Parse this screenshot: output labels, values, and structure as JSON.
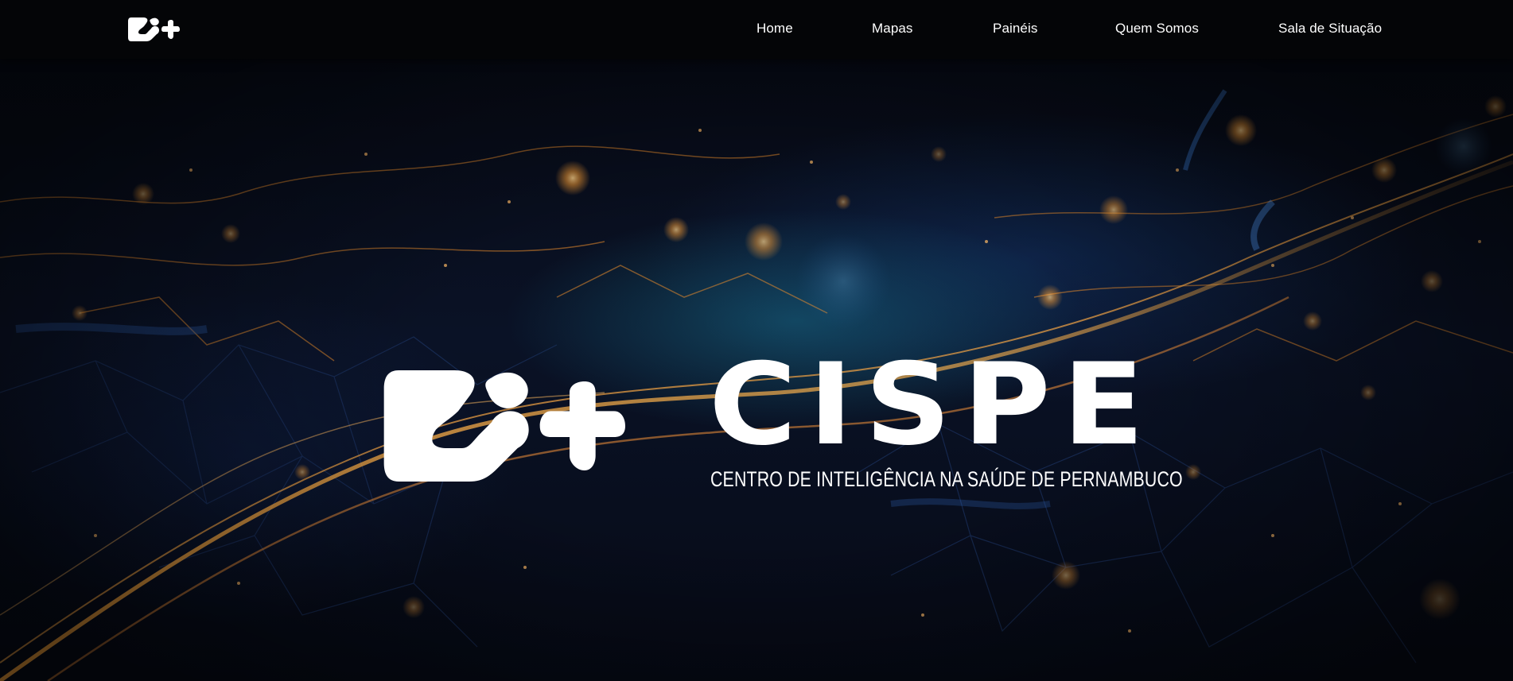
{
  "navbar": {
    "logo_icon": "cispe-logo-icon",
    "links": [
      {
        "label": "Home"
      },
      {
        "label": "Mapas"
      },
      {
        "label": "Painéis"
      },
      {
        "label": "Quem Somos"
      },
      {
        "label": "Sala de Situação"
      }
    ]
  },
  "hero": {
    "background": "network-lines-image",
    "logo_icon": "cispe-logo-icon",
    "title": "CISPE",
    "subtitle": "CENTRO DE INTELIGÊNCIA NA SAÚDE DE PERNAMBUCO"
  },
  "colors": {
    "nav_background": "#040507",
    "text": "#ffffff",
    "accent_orange": "#f0a040",
    "accent_blue": "#2a8ab0"
  }
}
